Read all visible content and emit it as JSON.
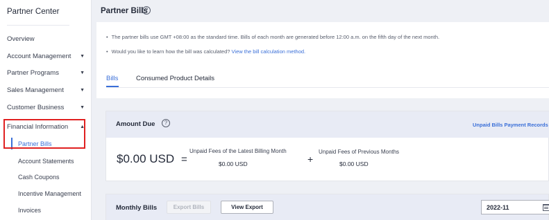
{
  "sidebar": {
    "title": "Partner Center",
    "items": [
      {
        "label": "Overview",
        "expandable": false
      },
      {
        "label": "Account Management",
        "expandable": true,
        "arrow": "▼"
      },
      {
        "label": "Partner Programs",
        "expandable": true,
        "arrow": "▼"
      },
      {
        "label": "Sales Management",
        "expandable": true,
        "arrow": "▼"
      },
      {
        "label": "Customer Business",
        "expandable": true,
        "arrow": "▼"
      },
      {
        "label": "Financial Information",
        "expandable": true,
        "arrow": "▲",
        "expanded": true
      }
    ],
    "subitems": [
      {
        "label": "Partner Bills",
        "active": true
      },
      {
        "label": "Account Statements"
      },
      {
        "label": "Cash Coupons"
      },
      {
        "label": "Incentive Management"
      },
      {
        "label": "Invoices"
      }
    ]
  },
  "page": {
    "title": "Partner Bills",
    "help_glyph": "?"
  },
  "notes": {
    "line1": "The partner bills use GMT +08:00 as the standard time. Bills of each month are generated before 12:00 a.m. on the fifth day of the next month.",
    "line2_prefix": "Would you like to learn how the bill was calculated?",
    "line2_link": "View the bill calculation method."
  },
  "tabs": [
    {
      "label": "Bills",
      "active": true
    },
    {
      "label": "Consumed Product Details",
      "active": false
    }
  ],
  "amount_due": {
    "title": "Amount Due",
    "link_unpaid": "Unpaid Bills",
    "link_payment": "Payment Records",
    "total": "$0.00 USD",
    "equals": "=",
    "plus": "+",
    "latest_label": "Unpaid Fees of the Latest Billing Month",
    "latest_value": "$0.00 USD",
    "previous_label": "Unpaid Fees of Previous Months",
    "previous_value": "$0.00 USD"
  },
  "monthly_bills": {
    "title": "Monthly Bills",
    "export_label": "Export Bills",
    "view_export_label": "View Export",
    "date_value": "2022-11"
  },
  "colors": {
    "accent": "#3a6fd8",
    "highlight_border": "#e02020",
    "panel_head": "#e8ebf5"
  }
}
